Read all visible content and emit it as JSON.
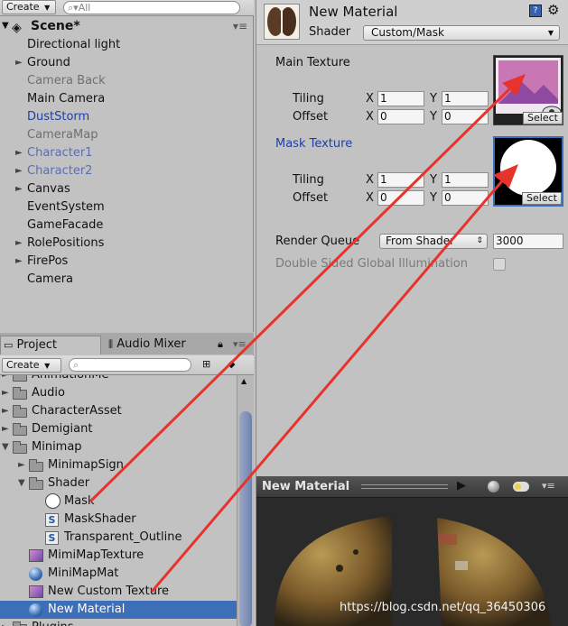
{
  "hierarchy": {
    "create_label": "Create",
    "search_placeholder": "All",
    "scene_title": "Scene*",
    "items": [
      {
        "label": "Directional light",
        "color": "#111111",
        "arrow": false
      },
      {
        "label": "Ground",
        "color": "#111111",
        "arrow": true
      },
      {
        "label": "Camera Back",
        "color": "#6f6f6f",
        "arrow": false
      },
      {
        "label": "Main Camera",
        "color": "#111111",
        "arrow": false
      },
      {
        "label": "DustStorm",
        "color": "#1f3fa0",
        "arrow": false
      },
      {
        "label": "CameraMap",
        "color": "#6f6f6f",
        "arrow": false
      },
      {
        "label": "Character1",
        "color": "#5b6fb0",
        "arrow": true
      },
      {
        "label": "Character2",
        "color": "#5b6fb0",
        "arrow": true
      },
      {
        "label": "Canvas",
        "color": "#111111",
        "arrow": true
      },
      {
        "label": "EventSystem",
        "color": "#111111",
        "arrow": false
      },
      {
        "label": "GameFacade",
        "color": "#111111",
        "arrow": false
      },
      {
        "label": "RolePositions",
        "color": "#111111",
        "arrow": true
      },
      {
        "label": "FirePos",
        "color": "#111111",
        "arrow": true
      },
      {
        "label": "Camera",
        "color": "#111111",
        "arrow": false
      }
    ]
  },
  "project": {
    "tab_project": "Project",
    "tab_audio": "Audio Mixer",
    "create_label": "Create",
    "items": [
      {
        "label": "AnimationMe",
        "type": "folder",
        "indent": 0,
        "arrow": "►"
      },
      {
        "label": "Audio",
        "type": "folder",
        "indent": 0,
        "arrow": "►"
      },
      {
        "label": "CharacterAsset",
        "type": "folder",
        "indent": 0,
        "arrow": "►"
      },
      {
        "label": "Demigiant",
        "type": "folder",
        "indent": 0,
        "arrow": "►"
      },
      {
        "label": "Minimap",
        "type": "folder",
        "indent": 0,
        "arrow": "▼"
      },
      {
        "label": "MinimapSign",
        "type": "folder",
        "indent": 1,
        "arrow": "►"
      },
      {
        "label": "Shader",
        "type": "folder",
        "indent": 1,
        "arrow": "▼"
      },
      {
        "label": "Mask",
        "type": "mask",
        "indent": 2,
        "arrow": ""
      },
      {
        "label": "MaskShader",
        "type": "shader",
        "indent": 2,
        "arrow": ""
      },
      {
        "label": "Transparent_Outline",
        "type": "shader",
        "indent": 2,
        "arrow": ""
      },
      {
        "label": "MimiMapTexture",
        "type": "texture",
        "indent": 1,
        "arrow": ""
      },
      {
        "label": "MiniMapMat",
        "type": "material",
        "indent": 1,
        "arrow": ""
      },
      {
        "label": "New Custom Texture",
        "type": "texture",
        "indent": 1,
        "arrow": ""
      },
      {
        "label": "New Material",
        "type": "material",
        "indent": 1,
        "arrow": "",
        "selected": true
      },
      {
        "label": "Plugins",
        "type": "folder",
        "indent": 0,
        "arrow": "►"
      }
    ]
  },
  "inspector": {
    "title": "New Material",
    "shader_label": "Shader",
    "shader_value": "Custom/Mask",
    "main_texture_label": "Main Texture",
    "mask_texture_label": "Mask Texture",
    "tiling_label": "Tiling",
    "offset_label": "Offset",
    "x_label": "X",
    "y_label": "Y",
    "main": {
      "tiling_x": "1",
      "tiling_y": "1",
      "offset_x": "0",
      "offset_y": "0"
    },
    "mask": {
      "tiling_x": "1",
      "tiling_y": "1",
      "offset_x": "0",
      "offset_y": "0"
    },
    "select_label": "Select",
    "render_queue_label": "Render Queue",
    "render_queue_mode": "From Shader",
    "render_queue_value": "3000",
    "double_sided_label": "Double Sided Global Illumination"
  },
  "preview": {
    "title": "New Material"
  },
  "watermark": "https://blog.csdn.net/qq_36450306",
  "colors": {
    "arrow_red": "#e8322c",
    "selection": "#3d6fb8",
    "link_blue": "#1f3fa0"
  }
}
